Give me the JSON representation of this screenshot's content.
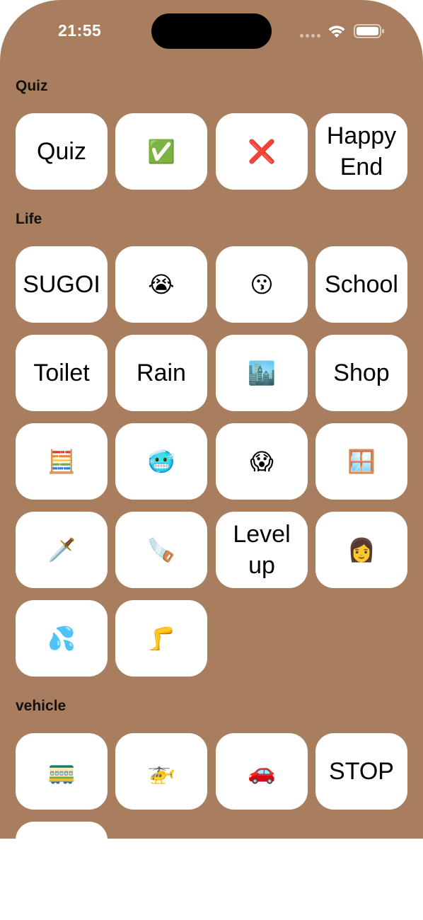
{
  "status_bar": {
    "time": "21:55",
    "wifi_icon": "wifi-icon",
    "battery_icon": "battery-icon"
  },
  "colors": {
    "background": "#a97e5e",
    "tile": "#ffffff",
    "text": "#000000"
  },
  "sections": [
    {
      "title": "Quiz",
      "tiles": [
        {
          "type": "text",
          "value": "Quiz"
        },
        {
          "type": "emoji",
          "value": "✅",
          "icon": "check-mark-icon"
        },
        {
          "type": "emoji",
          "value": "❌",
          "icon": "cross-mark-icon"
        },
        {
          "type": "text",
          "value": "Happy\nEnd"
        }
      ]
    },
    {
      "title": "Life",
      "tiles": [
        {
          "type": "text",
          "value": "SUGOI"
        },
        {
          "type": "emoji",
          "value": "😭",
          "icon": "crying-face-icon"
        },
        {
          "type": "emoji",
          "value": "😗",
          "icon": "kissing-face-icon"
        },
        {
          "type": "text",
          "value": "School"
        },
        {
          "type": "text",
          "value": "Toilet"
        },
        {
          "type": "text",
          "value": "Rain"
        },
        {
          "type": "emoji",
          "value": "🏙️",
          "icon": "cityscape-icon"
        },
        {
          "type": "text",
          "value": "Shop"
        },
        {
          "type": "emoji",
          "value": "🧮",
          "icon": "abacus-icon"
        },
        {
          "type": "emoji",
          "value": "🥶",
          "icon": "cold-face-icon"
        },
        {
          "type": "emoji",
          "value": "😱",
          "icon": "screaming-face-icon"
        },
        {
          "type": "emoji",
          "value": "🪟",
          "icon": "window-icon"
        },
        {
          "type": "emoji",
          "value": "🗡️",
          "icon": "dagger-icon"
        },
        {
          "type": "emoji",
          "value": "🪚",
          "icon": "saw-icon"
        },
        {
          "type": "text",
          "value": "Level\nup"
        },
        {
          "type": "emoji",
          "value": "👩",
          "icon": "woman-icon"
        },
        {
          "type": "emoji",
          "value": "💦",
          "icon": "sweat-droplets-icon"
        },
        {
          "type": "emoji",
          "value": "🦵",
          "icon": "leg-icon"
        }
      ]
    },
    {
      "title": "vehicle",
      "tiles": [
        {
          "type": "emoji",
          "value": "🚃",
          "icon": "train-car-icon"
        },
        {
          "type": "emoji",
          "value": "🚁",
          "icon": "helicopter-icon"
        },
        {
          "type": "emoji",
          "value": "🚗",
          "icon": "car-icon"
        },
        {
          "type": "text",
          "value": "STOP"
        },
        {
          "type": "text",
          "value": ""
        }
      ]
    }
  ]
}
